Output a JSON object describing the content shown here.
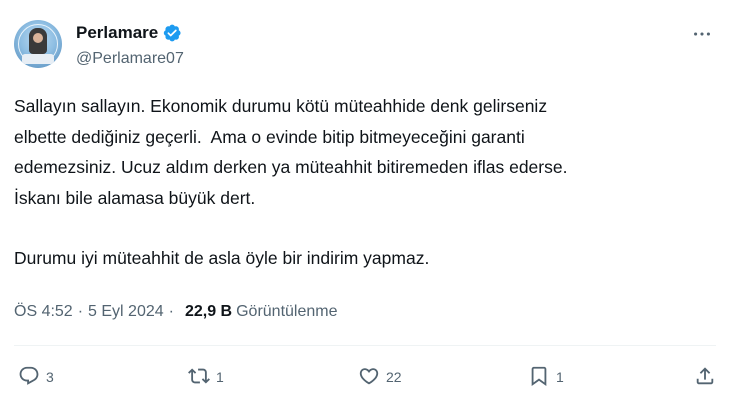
{
  "author": {
    "display_name": "Perlamare",
    "handle": "@Perlamare07",
    "verified": true,
    "avatar_icon": "avatar-image",
    "verified_color": "#1d9bf0"
  },
  "tweet": {
    "paragraph1": "Sallayın sallayın. Ekonomik durumu kötü müteahhide denk gelirseniz\nelbette dediğiniz geçerli.  Ama o evinde bitip bitmeyeceğini garanti\nedemezsiniz. Ucuz aldım derken ya müteahhit bitiremeden iflas ederse.\nİskanı bile alamasa büyük dert.",
    "paragraph2": "Durumu iyi müteahhit de asla öyle bir indirim yapmaz."
  },
  "meta": {
    "time": "ÖS 4:52",
    "separator": "·",
    "date": "5 Eyl 2024",
    "separator2": "·",
    "views_count": "22,9 B",
    "views_label": "Görüntülenme"
  },
  "actions": {
    "reply_count": "3",
    "retweet_count": "1",
    "like_count": "22",
    "bookmark_count": "1"
  },
  "colors": {
    "text_primary": "#0f1419",
    "text_secondary": "#536471"
  }
}
